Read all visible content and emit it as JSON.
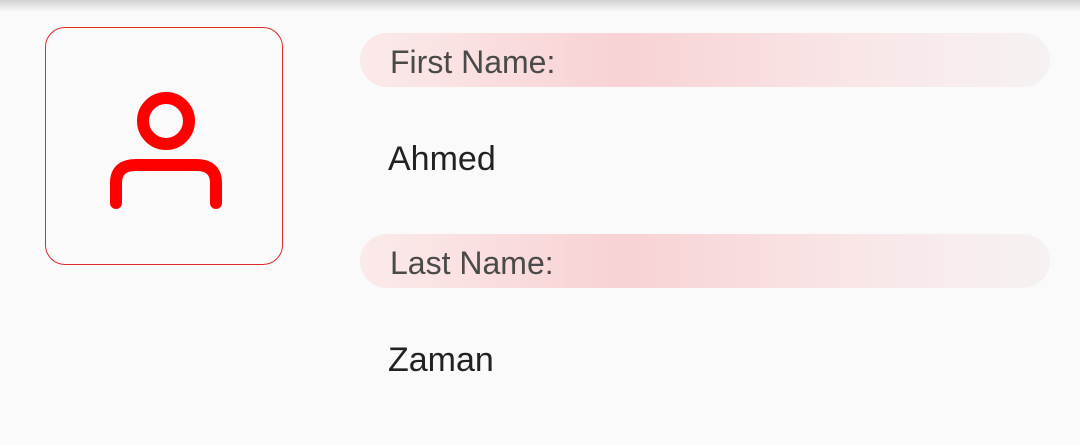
{
  "avatar": {
    "icon": "user-icon",
    "accent_color": "#ff0000",
    "border_color": "#e0282d"
  },
  "profile": {
    "first_name_label": "First Name:",
    "first_name_value": "Ahmed",
    "last_name_label": "Last Name:",
    "last_name_value": "Zaman"
  },
  "colors": {
    "background": "#fafafa",
    "pill_tint": "#f8d2d4",
    "label_text": "#4a4a4a",
    "value_text": "#222222"
  }
}
